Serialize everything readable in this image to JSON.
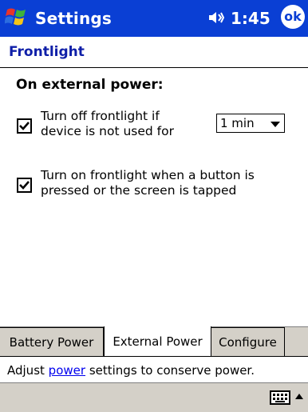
{
  "titlebar": {
    "app_title": "Settings",
    "time": "1:45",
    "ok_label": "ok"
  },
  "header": {
    "page_title": "Frontlight"
  },
  "content": {
    "section_heading": "On external power:",
    "option1": {
      "checked": true,
      "line1": "Turn off frontlight if",
      "line2": "device is not used for",
      "timeout_value": "1 min"
    },
    "option2": {
      "checked": true,
      "line1": "Turn on frontlight when a button is",
      "line2": "pressed or the screen is tapped"
    }
  },
  "tabs": [
    {
      "label": "Battery Power",
      "active": false
    },
    {
      "label": "External Power",
      "active": true
    },
    {
      "label": "Configure",
      "active": false
    }
  ],
  "help": {
    "prefix": "Adjust ",
    "link": "power",
    "suffix": " settings to conserve power."
  },
  "menubar": {
    "input_icon": "keyboard-icon"
  },
  "colors": {
    "titlebar_bg": "#0a3fd4",
    "page_title": "#0f1fa8",
    "link": "#0000ee",
    "bar_gray": "#d4d0c8"
  }
}
